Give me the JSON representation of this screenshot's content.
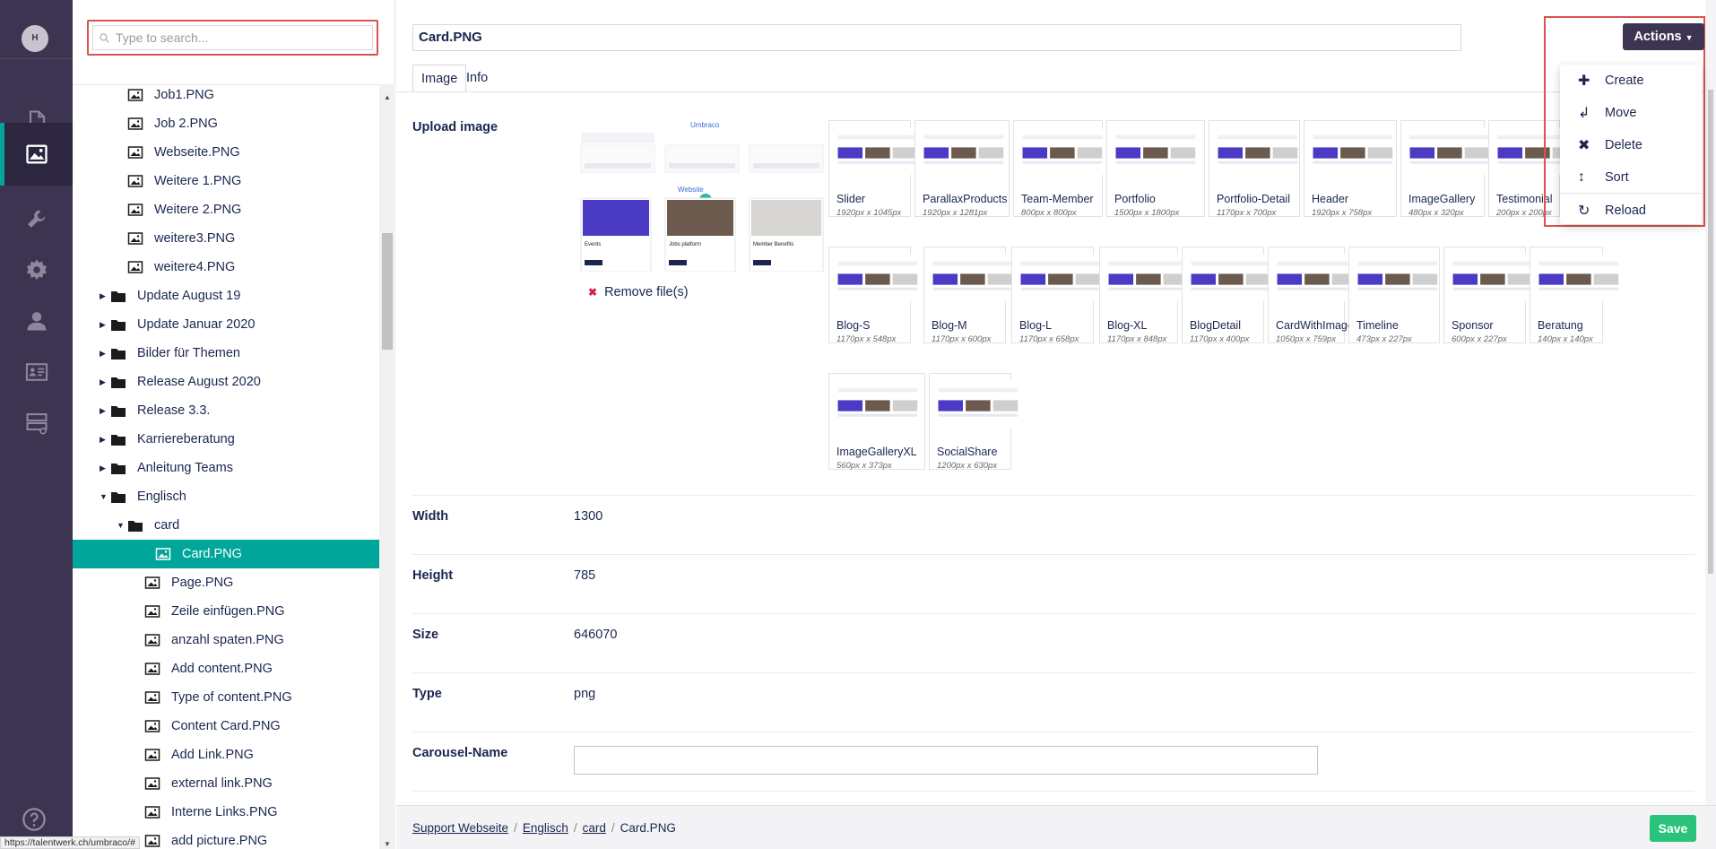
{
  "rail": {
    "avatar_initial": "H",
    "items": [
      {
        "name": "content",
        "icon": "document-icon"
      },
      {
        "name": "media",
        "icon": "image-icon",
        "active": true
      },
      {
        "name": "settings",
        "icon": "wrench-icon"
      },
      {
        "name": "packages",
        "icon": "gear-icon"
      },
      {
        "name": "users",
        "icon": "user-icon"
      },
      {
        "name": "members",
        "icon": "id-card-icon"
      },
      {
        "name": "forms",
        "icon": "form-icon"
      }
    ],
    "help_icon": "help-icon"
  },
  "tree": {
    "search_placeholder": "Type to search...",
    "nodes": [
      {
        "label": "Job1.PNG",
        "type": "image",
        "level": 1
      },
      {
        "label": "Job 2.PNG",
        "type": "image",
        "level": 1
      },
      {
        "label": "Webseite.PNG",
        "type": "image",
        "level": 1
      },
      {
        "label": "Weitere 1.PNG",
        "type": "image",
        "level": 1
      },
      {
        "label": "Weitere 2.PNG",
        "type": "image",
        "level": 1
      },
      {
        "label": "weitere3.PNG",
        "type": "image",
        "level": 1
      },
      {
        "label": "weitere4.PNG",
        "type": "image",
        "level": 1
      },
      {
        "label": "Update August 19",
        "type": "folder",
        "level": 0,
        "caret": "right"
      },
      {
        "label": "Update Januar 2020",
        "type": "folder",
        "level": 0,
        "caret": "right"
      },
      {
        "label": "Bilder für Themen",
        "type": "folder",
        "level": 0,
        "caret": "right"
      },
      {
        "label": "Release August 2020",
        "type": "folder",
        "level": 0,
        "caret": "right"
      },
      {
        "label": "Release 3.3.",
        "type": "folder",
        "level": 0,
        "caret": "right"
      },
      {
        "label": "Karriereberatung",
        "type": "folder",
        "level": 0,
        "caret": "right"
      },
      {
        "label": "Anleitung Teams",
        "type": "folder",
        "level": 0,
        "caret": "right"
      },
      {
        "label": "Englisch",
        "type": "folder",
        "level": 0,
        "caret": "down"
      },
      {
        "label": "card",
        "type": "folder",
        "level": 1,
        "caret": "down"
      },
      {
        "label": "Card.PNG",
        "type": "image",
        "level": 2,
        "selected": true
      },
      {
        "label": "Page.PNG",
        "type": "image",
        "level": 2
      },
      {
        "label": "Zeile einfügen.PNG",
        "type": "image",
        "level": 2
      },
      {
        "label": "anzahl spaten.PNG",
        "type": "image",
        "level": 2
      },
      {
        "label": "Add content.PNG",
        "type": "image",
        "level": 2
      },
      {
        "label": "Type of content.PNG",
        "type": "image",
        "level": 2
      },
      {
        "label": "Content Card.PNG",
        "type": "image",
        "level": 2
      },
      {
        "label": "Add Link.PNG",
        "type": "image",
        "level": 2
      },
      {
        "label": "external link.PNG",
        "type": "image",
        "level": 2
      },
      {
        "label": "Interne Links.PNG",
        "type": "image",
        "level": 2
      },
      {
        "label": "add picture.PNG",
        "type": "image",
        "level": 2
      }
    ]
  },
  "editor": {
    "name": "Card.PNG",
    "tabs": [
      "Image",
      "Info"
    ],
    "upload_label": "Upload image",
    "remove_label": "Remove file(s)",
    "preview_texts": {
      "brand": "Umbraco",
      "website": "Website",
      "col1": "Events",
      "col2": "Jobs platform",
      "col3": "Member Benefits"
    },
    "crops": [
      {
        "name": "Slider",
        "size": "1920px x 1045px"
      },
      {
        "name": "ParallaxProducts",
        "size": "1920px x 1281px"
      },
      {
        "name": "Team-Member",
        "size": "800px x 800px"
      },
      {
        "name": "Portfolio",
        "size": "1500px x 1800px"
      },
      {
        "name": "Portfolio-Detail",
        "size": "1170px x 700px"
      },
      {
        "name": "Header",
        "size": "1920px x 758px"
      },
      {
        "name": "ImageGallery",
        "size": "480px x 320px"
      },
      {
        "name": "Testimonial",
        "size": "200px x 200px"
      },
      {
        "name": "Blog-S",
        "size": "1170px x 548px"
      },
      {
        "name": "Blog-M",
        "size": "1170px x 600px"
      },
      {
        "name": "Blog-L",
        "size": "1170px x 658px"
      },
      {
        "name": "Blog-XL",
        "size": "1170px x 848px"
      },
      {
        "name": "BlogDetail",
        "size": "1170px x 400px"
      },
      {
        "name": "CardWithImage",
        "size": "1050px x 759px"
      },
      {
        "name": "Timeline",
        "size": "473px x 227px"
      },
      {
        "name": "Sponsor",
        "size": "600px x 227px"
      },
      {
        "name": "Beratung",
        "size": "140px x 140px"
      },
      {
        "name": "ImageGalleryXL",
        "size": "560px x 373px"
      },
      {
        "name": "SocialShare",
        "size": "1200px x 630px"
      }
    ],
    "properties": {
      "width_label": "Width",
      "width_value": "1300",
      "height_label": "Height",
      "height_value": "785",
      "size_label": "Size",
      "size_value": "646070",
      "type_label": "Type",
      "type_value": "png",
      "carousel_label": "Carousel-Name",
      "carousel_value": ""
    }
  },
  "actions": {
    "button_label": "Actions",
    "items": [
      {
        "label": "Create",
        "icon": "plus-icon"
      },
      {
        "label": "Move",
        "icon": "move-icon"
      },
      {
        "label": "Delete",
        "icon": "delete-icon"
      },
      {
        "label": "Sort",
        "icon": "sort-icon"
      },
      {
        "label": "Reload",
        "icon": "reload-icon"
      }
    ]
  },
  "footer": {
    "breadcrumbs": [
      "Support Webseite",
      "Englisch",
      "card"
    ],
    "current": "Card.PNG",
    "save_label": "Save"
  },
  "status_url": "https://talentwerk.ch/umbraco/#",
  "colors": {
    "rail": "#3c3450",
    "accent": "#00a699",
    "save": "#2bc37c",
    "highlight": "#d9534f"
  }
}
